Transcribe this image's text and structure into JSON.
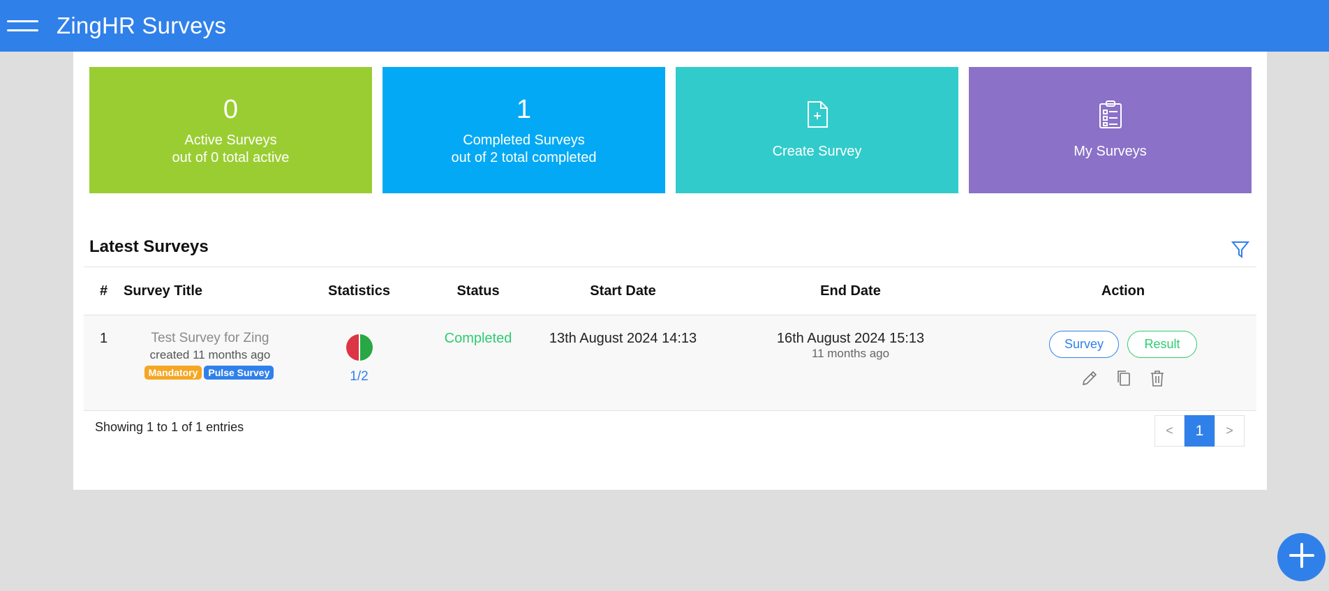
{
  "app": {
    "title": "ZingHR Surveys"
  },
  "tiles": {
    "active": {
      "count": "0",
      "label": "Active Surveys",
      "sub": "out of 0 total active",
      "color": "#9acd32"
    },
    "completed": {
      "count": "1",
      "label": "Completed Surveys",
      "sub": "out of 2 total completed",
      "color": "#03a9f4"
    },
    "create": {
      "label": "Create Survey",
      "icon": "file-plus-icon",
      "color": "#32cbcb"
    },
    "my": {
      "label": "My Surveys",
      "icon": "clipboard-list-icon",
      "color": "#8b71c8"
    }
  },
  "latest": {
    "title": "Latest Surveys",
    "columns": [
      "#",
      "Survey Title",
      "Statistics",
      "Status",
      "Start Date",
      "End Date",
      "Action"
    ],
    "rows": [
      {
        "index": "1",
        "title": "Test Survey for Zing",
        "created": "created 11 months ago",
        "badges": [
          {
            "label": "Mandatory",
            "color": "#f5a623"
          },
          {
            "label": "Pulse Survey",
            "color": "#3080ea"
          }
        ],
        "stats": "1/2",
        "status": "Completed",
        "start": "13th August 2024 14:13",
        "end": "16th August 2024 15:13",
        "end_ago": "11 months ago",
        "actions": {
          "survey": "Survey",
          "result": "Result"
        }
      }
    ]
  },
  "footer": {
    "showing": "Showing 1 to 1 of 1 entries",
    "pager": {
      "prev": "<",
      "page": "1",
      "next": ">"
    }
  },
  "colors": {
    "accent": "#3080ea",
    "success": "#2ecc71",
    "danger": "#dc3545"
  }
}
